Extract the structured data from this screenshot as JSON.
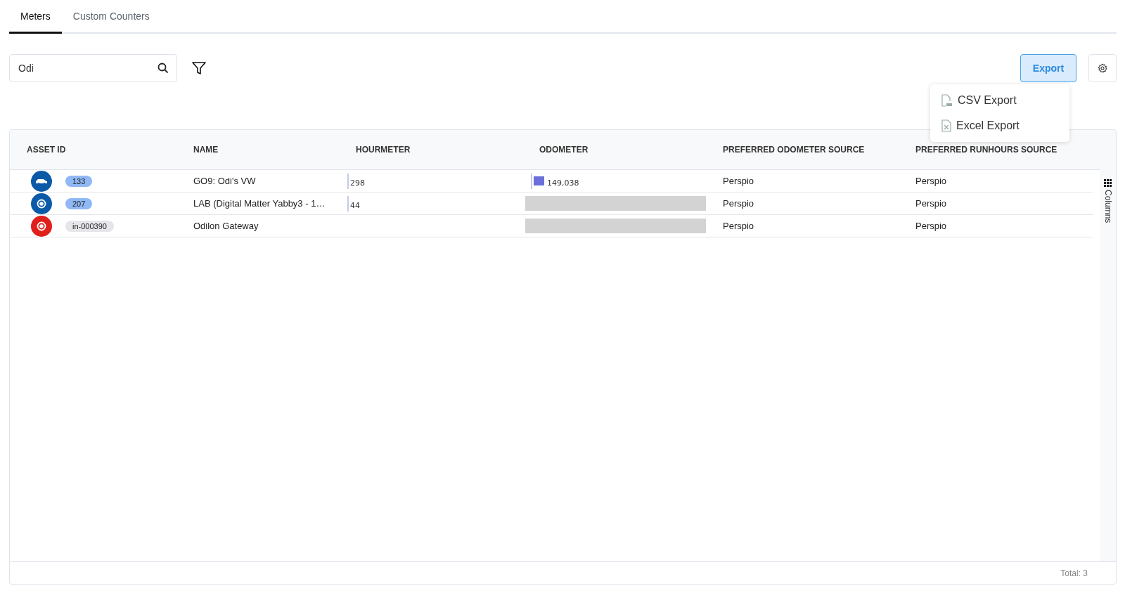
{
  "tabs": [
    {
      "label": "Meters",
      "selected": true
    },
    {
      "label": "Custom Counters",
      "selected": false
    }
  ],
  "search": {
    "value": "Odi"
  },
  "export_button": {
    "label": "Export",
    "expanded": true
  },
  "export_menu": [
    {
      "kind": "csv",
      "label": "CSV Export"
    },
    {
      "kind": "excel",
      "label": "Excel Export"
    }
  ],
  "table": {
    "columns": [
      "ASSET ID",
      "NAME",
      "HOURMETER",
      "ODOMETER",
      "PREFERRED ODOMETER SOURCE",
      "PREFERRED RUNHOURS SOURCE"
    ],
    "rows": [
      {
        "icon": {
          "kind": "car",
          "color": "#0b5aa8"
        },
        "asset_id": {
          "text": "133",
          "color": "#8fb8f5"
        },
        "name": "GO9: Odi's VW",
        "hourmeter": {
          "kind": "bar",
          "reading": "298"
        },
        "odometer": {
          "kind": "bar",
          "reading": "149,038"
        },
        "odometer_source": "Perspio",
        "runhours_source": "Perspio"
      },
      {
        "icon": {
          "kind": "target",
          "color": "#0b5aa8"
        },
        "asset_id": {
          "text": "207",
          "color": "#8fb8f5"
        },
        "name": "LAB (Digital Matter Yabby3 - 1…",
        "hourmeter": {
          "kind": "bar",
          "reading": "44"
        },
        "odometer": {
          "kind": "empty"
        },
        "odometer_source": "Perspio",
        "runhours_source": "Perspio"
      },
      {
        "icon": {
          "kind": "target",
          "color": "#e0201b"
        },
        "asset_id": {
          "text": "in-000390",
          "color": "#e6e6ea"
        },
        "name": "Odilon Gateway",
        "hourmeter": {
          "kind": "none"
        },
        "odometer": {
          "kind": "empty"
        },
        "odometer_source": "Perspio",
        "runhours_source": "Perspio"
      }
    ]
  },
  "columns_panel": {
    "label": "Columns"
  },
  "footer": {
    "total": "Total: 3"
  }
}
